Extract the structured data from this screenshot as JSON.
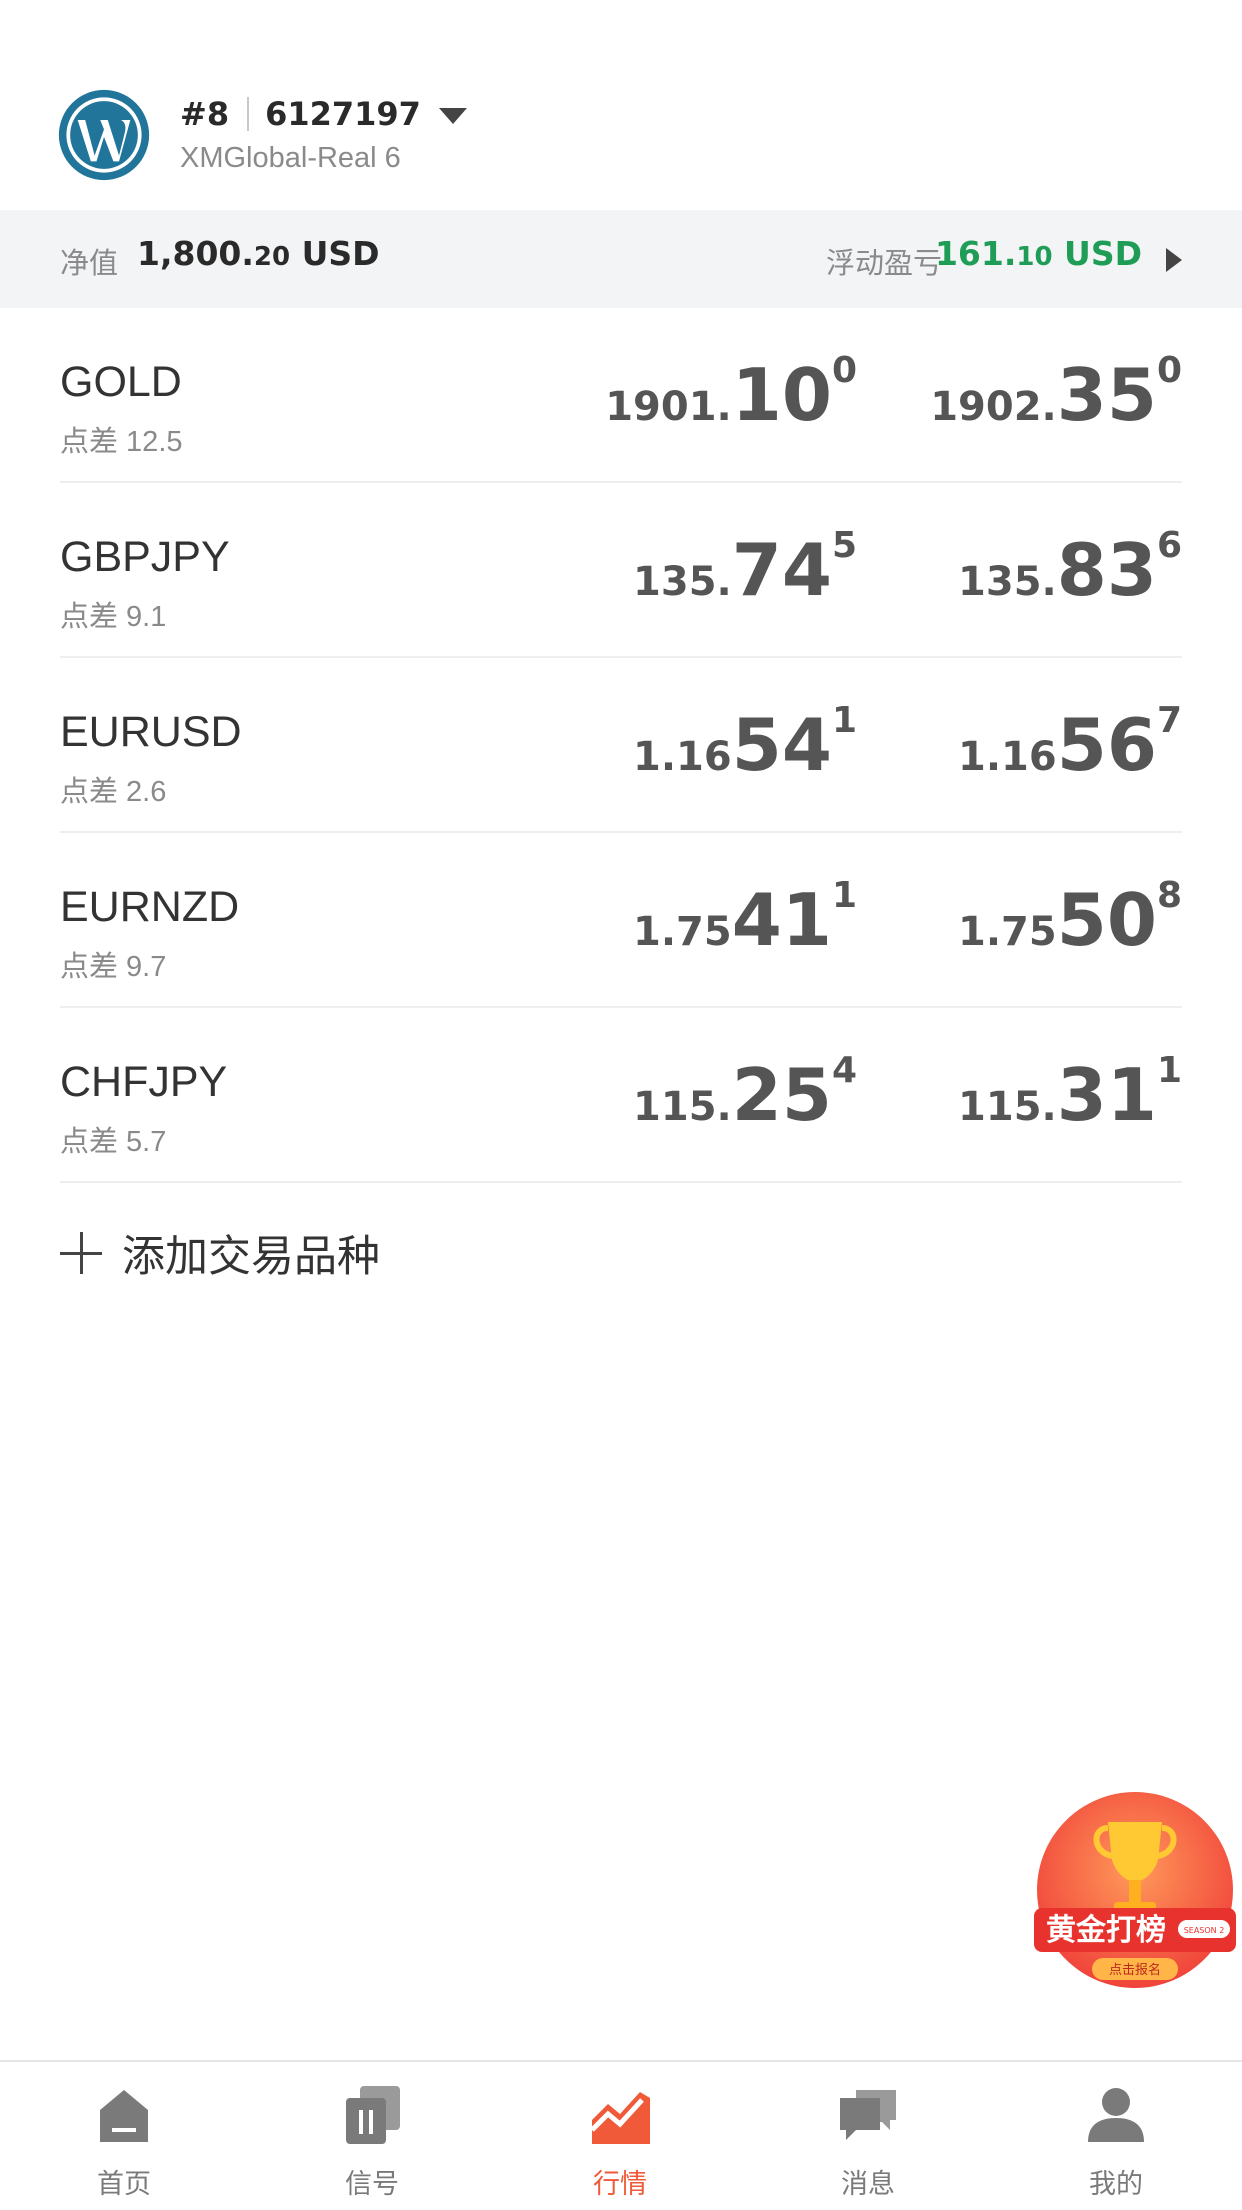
{
  "account": {
    "rank": "#8",
    "number": "6127197",
    "server": "XMGlobal-Real 6"
  },
  "summary": {
    "equity_label": "净值",
    "equity_main": "1,800.",
    "equity_decimals": "20",
    "equity_currency": " USD",
    "pl_label": "浮动盈亏",
    "pl_main": "161.",
    "pl_decimals": "10",
    "pl_currency": " USD",
    "pl_color": "#1f9d57"
  },
  "quotes": [
    {
      "symbol": "GOLD",
      "spread": "点差 12.5",
      "bid": {
        "pre": "1901.",
        "big": "10",
        "sup": "0"
      },
      "ask": {
        "pre": "1902.",
        "big": "35",
        "sup": "0"
      }
    },
    {
      "symbol": "GBPJPY",
      "spread": "点差 9.1",
      "bid": {
        "pre": "135.",
        "big": "74",
        "sup": "5"
      },
      "ask": {
        "pre": "135.",
        "big": "83",
        "sup": "6"
      }
    },
    {
      "symbol": "EURUSD",
      "spread": "点差 2.6",
      "bid": {
        "pre": "1.16",
        "big": "54",
        "sup": "1"
      },
      "ask": {
        "pre": "1.16",
        "big": "56",
        "sup": "7"
      }
    },
    {
      "symbol": "EURNZD",
      "spread": "点差 9.7",
      "bid": {
        "pre": "1.75",
        "big": "41",
        "sup": "1"
      },
      "ask": {
        "pre": "1.75",
        "big": "50",
        "sup": "8"
      }
    },
    {
      "symbol": "CHFJPY",
      "spread": "点差 5.7",
      "bid": {
        "pre": "115.",
        "big": "25",
        "sup": "4"
      },
      "ask": {
        "pre": "115.",
        "big": "31",
        "sup": "1"
      }
    }
  ],
  "add_instrument": "添加交易品种",
  "promo": {
    "title": "黄金打榜",
    "button": "点击报名",
    "season": "SEASON 2"
  },
  "tabs": [
    {
      "label": "首页",
      "icon": "home-icon"
    },
    {
      "label": "信号",
      "icon": "signal-icon"
    },
    {
      "label": "行情",
      "icon": "market-chart-icon",
      "active": true
    },
    {
      "label": "消息",
      "icon": "message-icon"
    },
    {
      "label": "我的",
      "icon": "profile-icon"
    }
  ],
  "colors": {
    "accent": "#f05a38",
    "profit": "#1f9d57",
    "logo": "#21759b"
  }
}
